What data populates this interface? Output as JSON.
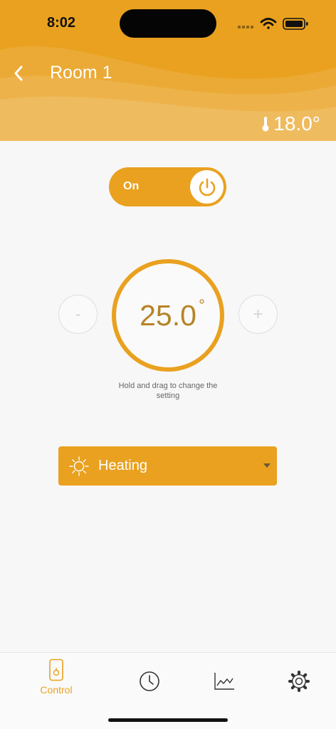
{
  "status_bar": {
    "time": "8:02"
  },
  "header": {
    "title": "Room 1",
    "current_temperature": "18.0°",
    "icons": [
      "back-chevron-icon",
      "thermometer-icon"
    ]
  },
  "power_toggle": {
    "label": "On",
    "state": "on",
    "icon": "power-icon"
  },
  "thermostat": {
    "setpoint": "25.0",
    "degree_symbol": "°",
    "decrease_label": "-",
    "increase_label": "+",
    "hint": "Hold and drag to change the setting"
  },
  "mode": {
    "selected": "Heating",
    "icon": "sun-icon"
  },
  "tabbar": {
    "tabs": [
      {
        "label": "Control",
        "icon": "thermostat-device-icon",
        "active": true
      },
      {
        "label": "",
        "icon": "clock-icon",
        "active": false
      },
      {
        "label": "",
        "icon": "chart-icon",
        "active": false
      },
      {
        "label": "",
        "icon": "gear-icon",
        "active": false
      }
    ]
  },
  "colors": {
    "accent": "#e9a11f",
    "setpoint_text": "#b78326",
    "background": "#f7f7f7"
  }
}
